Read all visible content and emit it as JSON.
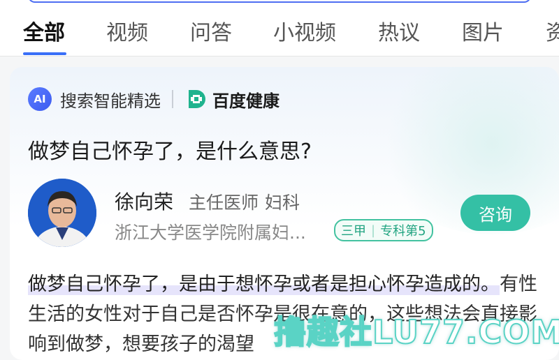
{
  "tabs": [
    "全部",
    "视频",
    "问答",
    "小视频",
    "热议",
    "图片",
    "资"
  ],
  "card": {
    "brand_ai_text": "AI",
    "brand_label": "搜索智能精选",
    "health_label": "百度健康",
    "question": "做梦自己怀孕了，是什么意思?",
    "doctor": {
      "name": "徐向荣",
      "title": "主任医师",
      "department": "妇科",
      "hospital": "浙江大学医学院附属妇...",
      "rank_a": "三甲",
      "rank_sep": "|",
      "rank_b": "专科第5"
    },
    "consult_label": "咨询",
    "answer_highlight": "做梦自己怀孕了，是由于想怀孕或者是担心怀孕造成的。",
    "answer_rest": "有性生活的女性对于自己是否怀孕是很在意的，这些想法会直接影响到做梦，想要孩子的渴望"
  },
  "watermark": "撸趣社LU77.COM",
  "colors": {
    "accent": "#3a6ff7",
    "consult": "#34c0a5",
    "rank": "#22a481"
  }
}
